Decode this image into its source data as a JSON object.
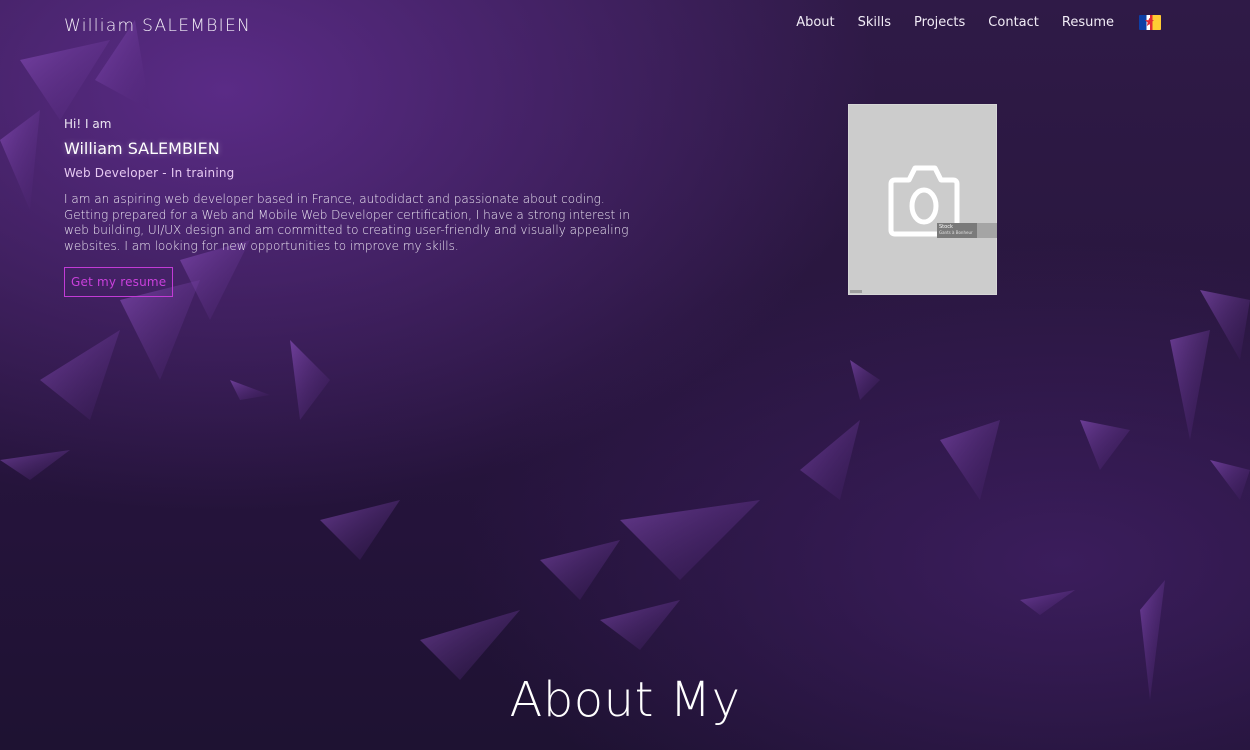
{
  "header": {
    "brand": "William SALEMBIEN",
    "nav": [
      {
        "label": "About"
      },
      {
        "label": "Skills"
      },
      {
        "label": "Projects"
      },
      {
        "label": "Contact"
      },
      {
        "label": "Resume"
      }
    ],
    "language_flag_icon": "french-canadian-flag-icon"
  },
  "hero": {
    "greeting": "Hi! I am",
    "name": "William SALEMBIEN",
    "role": "Web Developer - In training",
    "bio": "I am an aspiring web developer based in France, autodidact and passionate about coding. Getting prepared for a Web and Mobile Web Developer certification, I have a strong interest in web building, UI/UX design and am committed to creating user-friendly and visually appealing websites. I am looking for new opportunities to improve my skills.",
    "button_label": "Get my resume"
  },
  "photo": {
    "icon": "camera-icon",
    "stock_title": "Stock",
    "stock_subtitle": "Gants à Bonheur"
  },
  "section": {
    "title": "About My"
  },
  "colors": {
    "accent": "#c23bd6",
    "role_text": "#e6c9f2",
    "background_top": "#2f1a47",
    "background_bottom": "#1e1232"
  }
}
